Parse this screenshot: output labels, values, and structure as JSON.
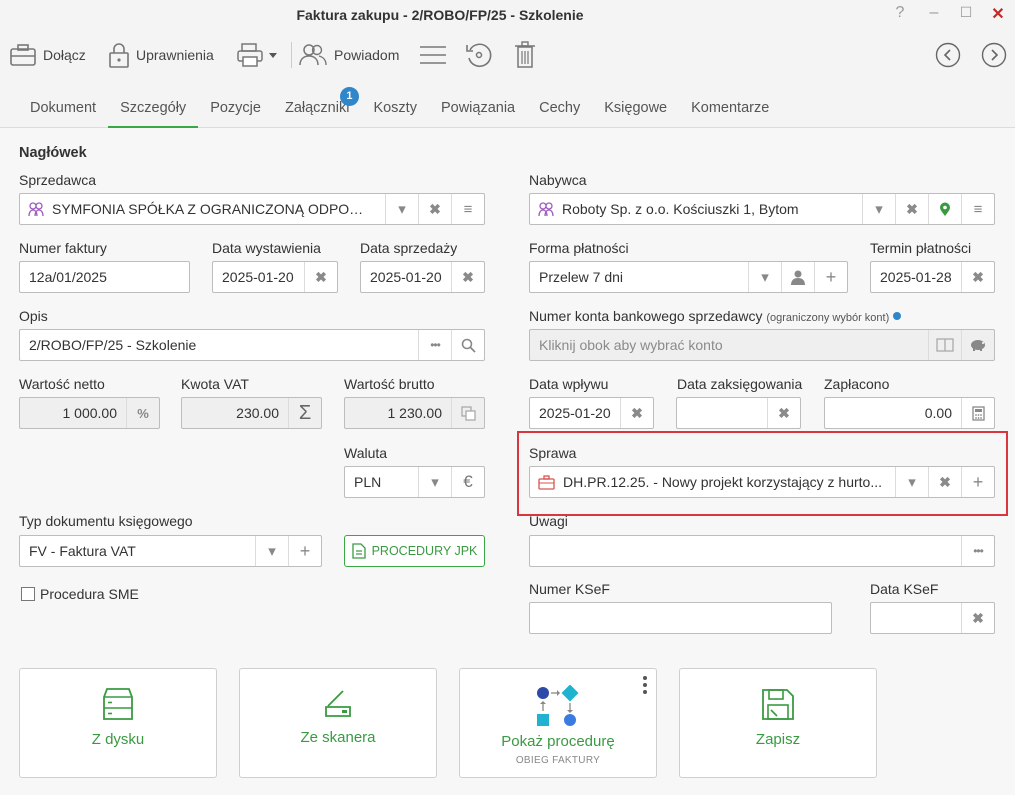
{
  "window": {
    "title": "Faktura zakupu - 2/ROBO/FP/25 - Szkolenie",
    "help": "?",
    "minimize": "–",
    "maximize": "☐",
    "close": "✕"
  },
  "toolbar": {
    "attach": "Dołącz",
    "permissions": "Uprawnienia",
    "notify": "Powiadom"
  },
  "tabs": [
    "Dokument",
    "Szczegóły",
    "Pozycje",
    "Załączniki",
    "Koszty",
    "Powiązania",
    "Cechy",
    "Księgowe",
    "Komentarze"
  ],
  "attachments_badge": "1",
  "section_header": "Nagłówek",
  "seller": {
    "label": "Sprzedawca",
    "value": "SYMFONIA SPÓŁKA Z OGRANICZONĄ ODPOWIE..."
  },
  "buyer": {
    "label": "Nabywca",
    "value": "Roboty Sp. z o.o. Kościuszki 1, Bytom"
  },
  "invoice_number": {
    "label": "Numer faktury",
    "value": "12a/01/2025"
  },
  "issue_date": {
    "label": "Data wystawienia",
    "value": "2025-01-20"
  },
  "sale_date": {
    "label": "Data sprzedaży",
    "value": "2025-01-20"
  },
  "payment_form": {
    "label": "Forma płatności",
    "value": "Przelew 7 dni"
  },
  "payment_due": {
    "label": "Termin płatności",
    "value": "2025-01-28"
  },
  "description": {
    "label": "Opis",
    "value": "2/ROBO/FP/25 - Szkolenie"
  },
  "bank_account": {
    "label": "Numer konta bankowego sprzedawcy",
    "note": "(ograniczony wybór kont)",
    "placeholder": "Kliknij obok aby wybrać konto"
  },
  "net_value": {
    "label": "Wartość netto",
    "value": "1 000.00",
    "btn": "%"
  },
  "vat_amount": {
    "label": "Kwota VAT",
    "value": "230.00"
  },
  "gross_value": {
    "label": "Wartość brutto",
    "value": "1 230.00"
  },
  "receipt_date": {
    "label": "Data wpływu",
    "value": "2025-01-20"
  },
  "posting_date": {
    "label": "Data zaksięgowania",
    "value": ""
  },
  "paid": {
    "label": "Zapłacono",
    "value": "0.00"
  },
  "currency": {
    "label": "Waluta",
    "value": "PLN",
    "btn": "€"
  },
  "case": {
    "label": "Sprawa",
    "value": "DH.PR.12.25. - Nowy projekt korzystający z hurto..."
  },
  "doc_type": {
    "label": "Typ dokumentu księgowego",
    "value": "FV - Faktura VAT"
  },
  "jpk_button": "PROCEDURY JPK",
  "notes": {
    "label": "Uwagi",
    "value": ""
  },
  "sme": {
    "label": "Procedura SME",
    "checked": false
  },
  "ksef_number": {
    "label": "Numer KSeF",
    "value": ""
  },
  "ksef_date": {
    "label": "Data KSeF",
    "value": ""
  },
  "actions": {
    "disk": "Z dysku",
    "scanner": "Ze skanera",
    "procedure": "Pokaż procedurę",
    "procedure_sub": "OBIEG FAKTURY",
    "save": "Zapisz"
  },
  "colors": {
    "accent": "#3aa746",
    "highlight": "#d9363e",
    "badge": "#2f86c9"
  }
}
